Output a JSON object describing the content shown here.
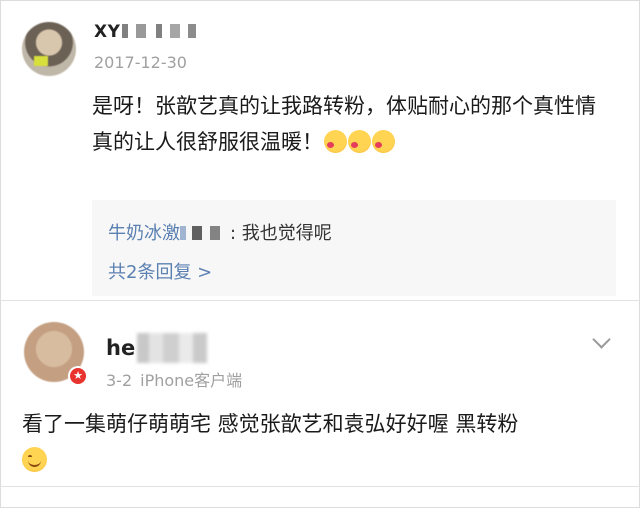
{
  "comment1": {
    "username": "XY",
    "date": "2017-12-30",
    "text": "是呀！张歆艺真的让我路转粉，体贴耐心的那个真性情真的让人很舒服很温暖！",
    "reply_preview": {
      "user": "牛奶冰激",
      "text": ": 我也觉得呢"
    },
    "more_replies": "共2条回复 >"
  },
  "comment2": {
    "username": "he",
    "date": "3-2",
    "source": "iPhone客户端",
    "text": "看了一集萌仔萌萌宅 感觉张歆艺和袁弘好好喔 黑转粉"
  },
  "colors": {
    "link": "#5b80b2",
    "meta": "#a0a0a0",
    "badge": "#e8332e",
    "reply_bg": "#f7f7f7"
  }
}
